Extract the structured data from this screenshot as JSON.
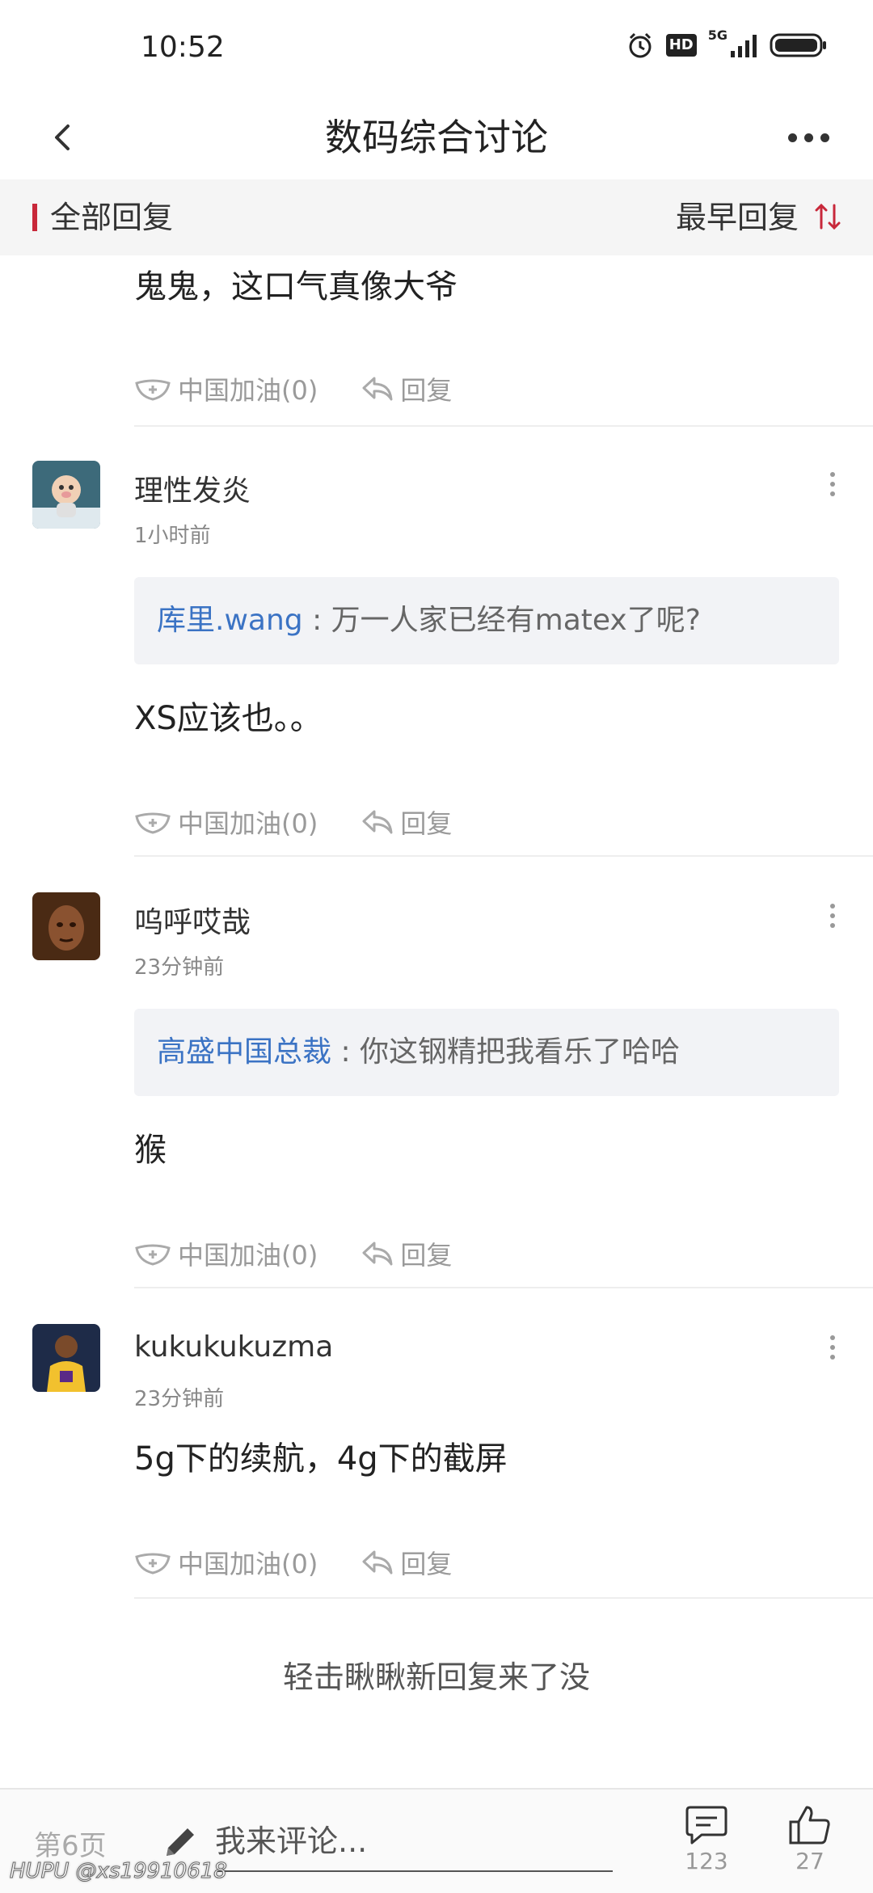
{
  "status_bar": {
    "time": "10:52",
    "alarm_icon": "alarm-clock-icon",
    "hd_label": "HD",
    "network": "5G",
    "signal_icon": "signal-bars-icon",
    "battery_icon": "battery-icon"
  },
  "header": {
    "title": "数码综合讨论",
    "back_icon": "chevron-left-icon",
    "more_icon": "more-dots-icon"
  },
  "filter": {
    "left_label": "全部回复",
    "sort_label": "最早回复",
    "sort_icon": "sort-arrows-icon"
  },
  "partial_post": {
    "text": "鬼鬼，这口气真像大爷",
    "like_label": "中国加油(0)",
    "reply_label": "回复"
  },
  "posts": [
    {
      "username": "理性发炎",
      "time": "1小时前",
      "quote_user": "库里.wang",
      "quote_text": " : 万一人家已经有matex了呢?",
      "text": "XS应该也。。",
      "like_label": "中国加油(0)",
      "reply_label": "回复"
    },
    {
      "username": "呜呼哎哉",
      "time": "23分钟前",
      "quote_user": "高盛中国总裁",
      "quote_text": " : 你这钢精把我看乐了哈哈",
      "text": "猴",
      "like_label": "中国加油(0)",
      "reply_label": "回复"
    },
    {
      "username": "kukukukuzma",
      "time": "23分钟前",
      "text": "5g下的续航，4g下的截屏",
      "like_label": "中国加油(0)",
      "reply_label": "回复"
    }
  ],
  "load_more": "轻击瞅瞅新回复来了没",
  "bottom_bar": {
    "page_indicator": "第6页",
    "comment_placeholder": "我来评论...",
    "comment_count": "123",
    "like_count": "27",
    "pencil_icon": "pencil-icon",
    "comment_icon": "comment-bubble-icon",
    "like_icon": "thumbs-up-icon"
  },
  "watermark": "HUPU @xs19910618",
  "colors": {
    "accent": "#c8283a",
    "link": "#3b73c4",
    "muted": "#9a9a9a"
  }
}
